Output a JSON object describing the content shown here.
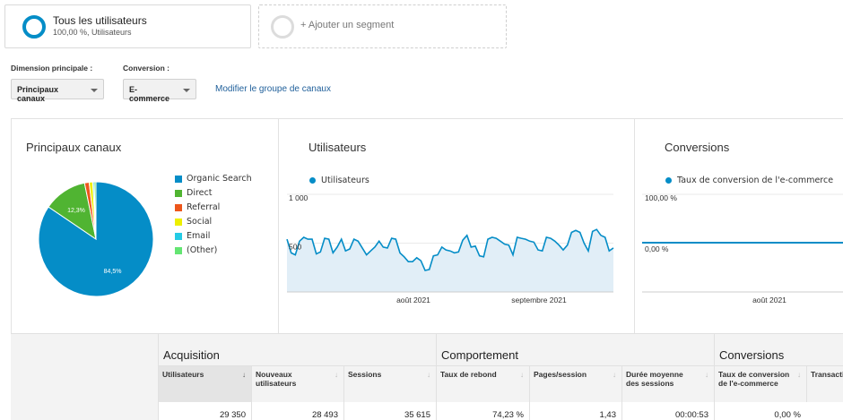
{
  "segments": {
    "main_title": "Tous les utilisateurs",
    "main_sub": "100,00 %, Utilisateurs",
    "add_label": "+ Ajouter un segment"
  },
  "controls": {
    "dimension_label": "Dimension principale :",
    "dimension_value": "Principaux canaux",
    "conversion_label": "Conversion :",
    "conversion_value": "E-commerce",
    "modify_link": "Modifier le groupe de canaux"
  },
  "pie": {
    "title": "Principaux canaux",
    "slices": [
      {
        "label": "Organic Search",
        "value": 84.5,
        "color": "#058dc7",
        "text": "84,5%"
      },
      {
        "label": "Direct",
        "value": 12.3,
        "color": "#50b432",
        "text": "12,3%"
      },
      {
        "label": "Referral",
        "value": 1.3,
        "color": "#ed561b",
        "text": ""
      },
      {
        "label": "Social",
        "value": 1.0,
        "color": "#edef00",
        "text": ""
      },
      {
        "label": "Email",
        "value": 0.4,
        "color": "#24cbe5",
        "text": ""
      },
      {
        "label": "(Other)",
        "value": 0.5,
        "color": "#64e572",
        "text": ""
      }
    ]
  },
  "users_chart": {
    "title": "Utilisateurs",
    "legend": "Utilisateurs",
    "ytick_top": "1 000",
    "ytick_mid": "500",
    "xtick_1": "août 2021",
    "xtick_2": "septembre 2021",
    "values": [
      540,
      400,
      380,
      520,
      560,
      540,
      540,
      390,
      410,
      550,
      540,
      400,
      460,
      540,
      420,
      440,
      540,
      520,
      450,
      380,
      420,
      460,
      520,
      460,
      450,
      550,
      540,
      400,
      360,
      310,
      310,
      350,
      320,
      220,
      230,
      370,
      380,
      460,
      430,
      420,
      400,
      410,
      530,
      580,
      460,
      470,
      370,
      360,
      540,
      560,
      550,
      520,
      490,
      480,
      380,
      560,
      550,
      540,
      520,
      510,
      430,
      420,
      560,
      550,
      520,
      480,
      430,
      480,
      610,
      630,
      610,
      500,
      420,
      620,
      640,
      580,
      560,
      420,
      450
    ],
    "ylim": [
      0,
      1000
    ]
  },
  "conv_chart": {
    "title": "Conversions",
    "legend": "Taux de conversion de l'e-commerce",
    "ytick_top": "100,00 %",
    "ytick_mid": "0,00 %",
    "xtick_1": "août 2021"
  },
  "table": {
    "groups": {
      "acquisition": "Acquisition",
      "behavior": "Comportement",
      "conversions": "Conversions"
    },
    "columns": {
      "users": "Utilisateurs",
      "new_users": "Nouveaux utilisateurs",
      "sessions": "Sessions",
      "bounce": "Taux de rebond",
      "pages": "Pages/session",
      "duration": "Durée moyenne des sessions",
      "conv_rate": "Taux de conversion de l'e-commerce",
      "transactions": "Transacti"
    },
    "totals": {
      "users": "29 350",
      "new_users": "28 493",
      "sessions": "35 615",
      "bounce": "74,23 %",
      "pages": "1,43",
      "duration": "00:00:53",
      "conv_rate": "0,00 %"
    }
  }
}
